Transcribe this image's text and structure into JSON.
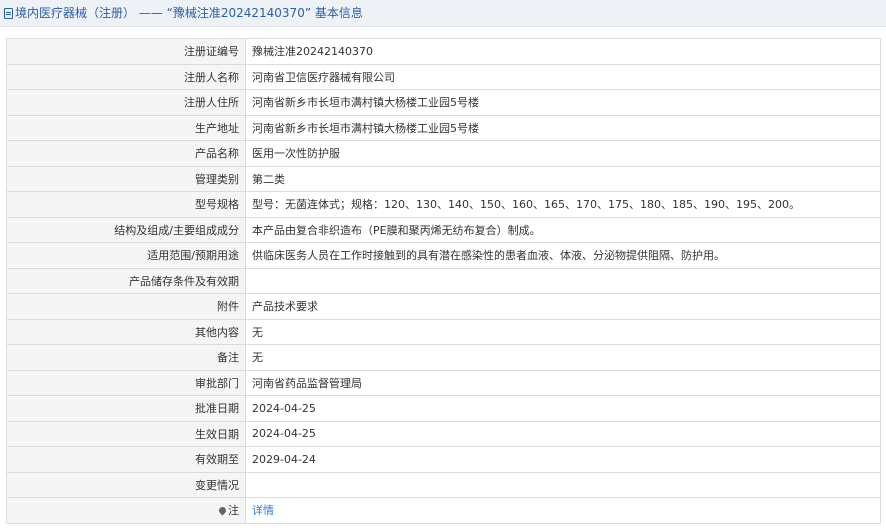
{
  "header": {
    "icon": "document-icon",
    "title": "境内医疗器械（注册） —— “豫械注准20242140370” 基本信息"
  },
  "rows": [
    {
      "label": "注册证编号",
      "value": "豫械注准20242140370"
    },
    {
      "label": "注册人名称",
      "value": "河南省卫信医疗器械有限公司"
    },
    {
      "label": "注册人住所",
      "value": "河南省新乡市长垣市满村镇大杨楼工业园5号楼"
    },
    {
      "label": "生产地址",
      "value": "河南省新乡市长垣市满村镇大杨楼工业园5号楼"
    },
    {
      "label": "产品名称",
      "value": "医用一次性防护服"
    },
    {
      "label": "管理类别",
      "value": "第二类"
    },
    {
      "label": "型号规格",
      "value": "型号：无菌连体式；规格：120、130、140、150、160、165、170、175、180、185、190、195、200。"
    },
    {
      "label": "结构及组成/主要组成成分",
      "value": "本产品由复合非织造布（PE膜和聚丙烯无纺布复合）制成。"
    },
    {
      "label": "适用范围/预期用途",
      "value": "供临床医务人员在工作时接触到的具有潜在感染性的患者血液、体液、分泌物提供阻隔、防护用。"
    },
    {
      "label": "产品储存条件及有效期",
      "value": ""
    },
    {
      "label": "附件",
      "value": "产品技术要求"
    },
    {
      "label": "其他内容",
      "value": "无"
    },
    {
      "label": "备注",
      "value": "无"
    },
    {
      "label": "审批部门",
      "value": "河南省药品监督管理局"
    },
    {
      "label": "批准日期",
      "value": "2024-04-25"
    },
    {
      "label": "生效日期",
      "value": "2024-04-25"
    },
    {
      "label": "有效期至",
      "value": "2029-04-24"
    },
    {
      "label": "变更情况",
      "value": ""
    }
  ],
  "note_row": {
    "icon": "pin-icon",
    "label": "注",
    "link_text": "详情"
  },
  "colors": {
    "title": "#2a5fa8",
    "link": "#2a7ed3",
    "label_bg": "#f5f5f5",
    "border": "#dcdcdc"
  }
}
